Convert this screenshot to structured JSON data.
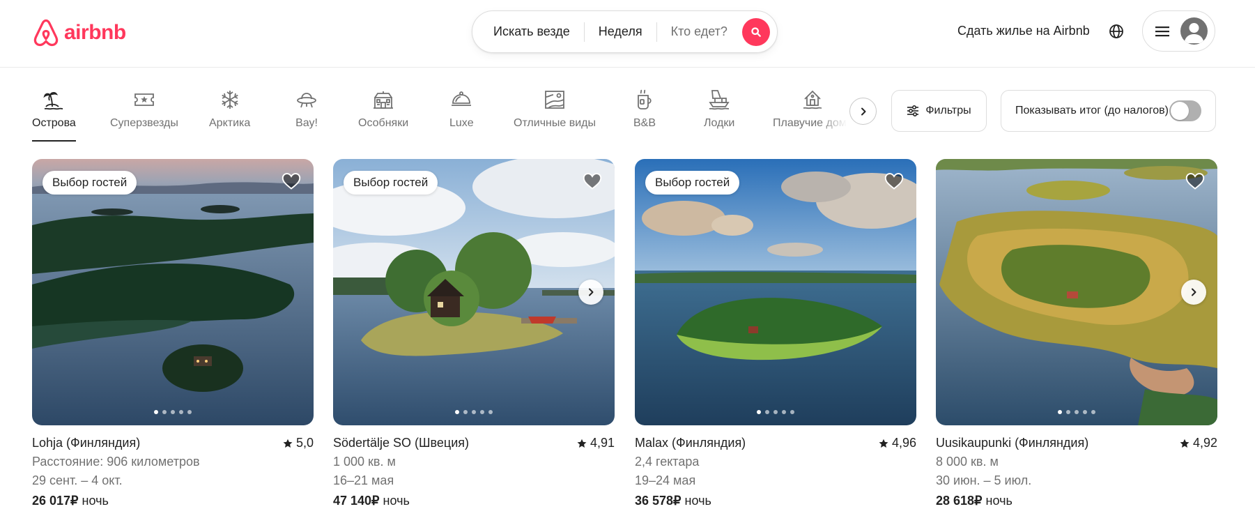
{
  "header": {
    "logo_text": "airbnb",
    "search": {
      "where": "Искать везде",
      "when": "Неделя",
      "who": "Кто едет?"
    },
    "host_link": "Сдать жилье на Airbnb"
  },
  "colors": {
    "brand": "#ff385c",
    "text": "#222222",
    "muted": "#717171",
    "border": "#dddddd"
  },
  "categories": [
    {
      "label": "Острова",
      "icon": "island-icon",
      "active": true
    },
    {
      "label": "Суперзвезды",
      "icon": "ticket-star-icon"
    },
    {
      "label": "Арктика",
      "icon": "snowflake-icon"
    },
    {
      "label": "Вау!",
      "icon": "ufo-icon"
    },
    {
      "label": "Особняки",
      "icon": "mansion-icon"
    },
    {
      "label": "Luxe",
      "icon": "cloche-icon"
    },
    {
      "label": "Отличные виды",
      "icon": "view-icon"
    },
    {
      "label": "B&B",
      "icon": "breakfast-icon"
    },
    {
      "label": "Лодки",
      "icon": "boat-icon"
    },
    {
      "label": "Плавучие дома",
      "icon": "houseboat-icon"
    }
  ],
  "filters_label": "Фильтры",
  "totals_label": "Показывать итог (до налогов)",
  "listings": [
    {
      "badge": "Выбор гостей",
      "title": "Lohja (Финляндия)",
      "rating": "5,0",
      "line2": "Расстояние: 906 километров",
      "dates": "29 сент. – 4 окт.",
      "price": "26 017₽",
      "price_unit": "ночь"
    },
    {
      "badge": "Выбор гостей",
      "title": "Södertälje SO (Швеция)",
      "rating": "4,91",
      "line2": "1 000 кв. м",
      "dates": "16–21 мая",
      "price": "47 140₽",
      "price_unit": "ночь"
    },
    {
      "badge": "Выбор гостей",
      "title": "Malax (Финляндия)",
      "rating": "4,96",
      "line2": "2,4 гектара",
      "dates": "19–24 мая",
      "price": "36 578₽",
      "price_unit": "ночь"
    },
    {
      "title": "Uusikaupunki (Финляндия)",
      "rating": "4,92",
      "line2": "8 000 кв. м",
      "dates": "30 июн. – 5 июл.",
      "price": "28 618₽",
      "price_unit": "ночь"
    }
  ]
}
